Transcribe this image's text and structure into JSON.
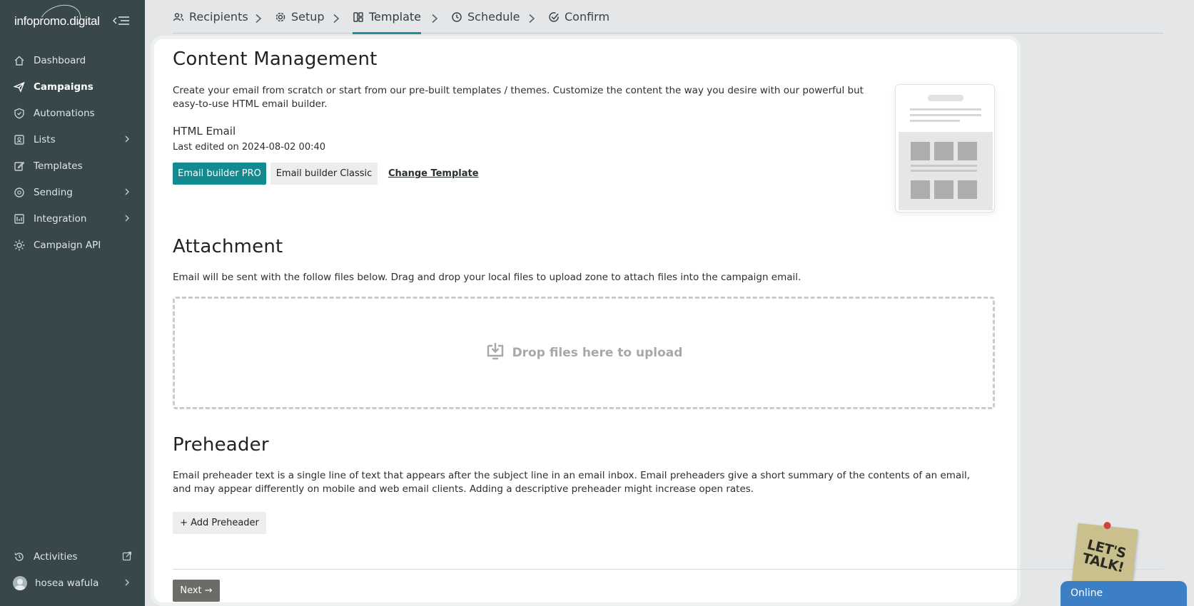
{
  "brand": {
    "logo_text": "infopromo.digital"
  },
  "sidebar": {
    "items": [
      {
        "label": "Dashboard",
        "icon": "home-icon"
      },
      {
        "label": "Campaigns",
        "icon": "paper-plane-icon",
        "active": true
      },
      {
        "label": "Automations",
        "icon": "shield-check-icon"
      },
      {
        "label": "Lists",
        "icon": "contact-list-icon",
        "has_submenu": true
      },
      {
        "label": "Templates",
        "icon": "edit-icon"
      },
      {
        "label": "Sending",
        "icon": "sending-icon",
        "has_submenu": true
      },
      {
        "label": "Integration",
        "icon": "integration-icon",
        "has_submenu": true
      },
      {
        "label": "Campaign API",
        "icon": "gear-api-icon"
      }
    ],
    "bottom": {
      "activities_label": "Activities",
      "user_name": "hosea wafula"
    }
  },
  "steps": [
    {
      "label": "Recipients",
      "icon": "users-icon"
    },
    {
      "label": "Setup",
      "icon": "gear-icon"
    },
    {
      "label": "Template",
      "icon": "layout-icon",
      "active": true
    },
    {
      "label": "Schedule",
      "icon": "clock-icon"
    },
    {
      "label": "Confirm",
      "icon": "check-circle-icon"
    }
  ],
  "content": {
    "title": "Content Management",
    "description": "Create your email from scratch or start from our pre-built templates / themes. Customize the content the way you desire with our powerful but easy-to-use HTML email builder.",
    "email_type": "HTML Email",
    "last_edited": "Last edited on 2024-08-02 00:40",
    "btn_pro": "Email builder PRO",
    "btn_classic": "Email builder Classic",
    "link_change": "Change Template"
  },
  "attachment": {
    "title": "Attachment",
    "description": "Email will be sent with the follow files below. Drag and drop your local files to upload zone to attach files into the campaign email.",
    "dropzone_label": "Drop files here to upload"
  },
  "preheader": {
    "title": "Preheader",
    "description": "Email preheader text is a single line of text that appears after the subject line in an email inbox. Email preheaders give a short summary of the contents of an email, and may appear differently on mobile and web email clients. Adding a descriptive preheader might increase open rates.",
    "btn_add": "+ Add Preheader"
  },
  "footer": {
    "btn_next": "Next →"
  },
  "chat": {
    "note_text": "LET'S TALK!",
    "status": "Online"
  },
  "colors": {
    "sidebar_bg": "#37474a",
    "accent": "#138a8f",
    "chat_blue": "#3d7fc4"
  }
}
